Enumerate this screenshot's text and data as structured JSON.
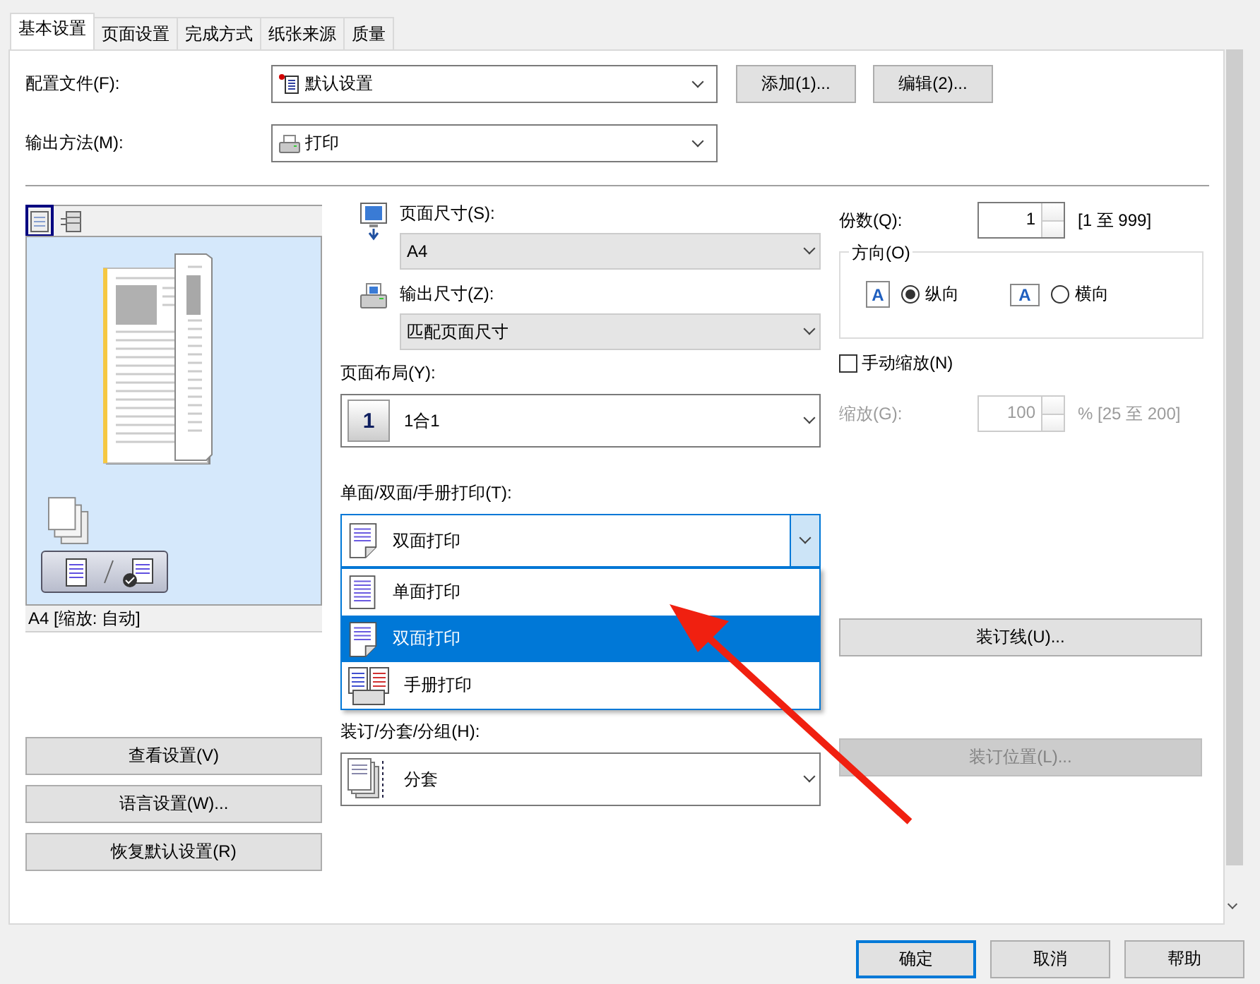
{
  "tabs": [
    {
      "label": "基本设置",
      "selected": true
    },
    {
      "label": "页面设置",
      "selected": false
    },
    {
      "label": "完成方式",
      "selected": false
    },
    {
      "label": "纸张来源",
      "selected": false
    },
    {
      "label": "质量",
      "selected": false
    }
  ],
  "profile": {
    "label": "配置文件(F):",
    "value": "默认设置"
  },
  "profile_buttons": [
    "添加(1)...",
    "编辑(2)..."
  ],
  "output_method": {
    "label": "输出方法(M):",
    "value": "打印"
  },
  "view_modes": [
    {
      "kind": "page",
      "selected": true
    },
    {
      "kind": "printer",
      "selected": false
    }
  ],
  "preview": {
    "status": "A4 [缩放: 自动]"
  },
  "left_buttons": [
    "查看设置(V)",
    "语言设置(W)...",
    "恢复默认设置(R)"
  ],
  "page_size": {
    "label": "页面尺寸(S):",
    "value": "A4"
  },
  "output_size": {
    "label": "输出尺寸(Z):",
    "value": "匹配页面尺寸"
  },
  "layout": {
    "label": "页面布局(Y):",
    "icon_text": "1",
    "value": "1合1"
  },
  "duplex": {
    "label": "单面/双面/手册打印(T):",
    "value": "双面打印",
    "expanded": true,
    "options": [
      {
        "kind": "simplex",
        "label": "单面打印",
        "selected": false
      },
      {
        "kind": "duplex",
        "label": "双面打印",
        "selected": true
      },
      {
        "kind": "booklet",
        "label": "手册打印",
        "selected": false
      }
    ]
  },
  "binding": {
    "label": "装订/分套/分组(H):",
    "value": "分套"
  },
  "copies": {
    "label": "份数(Q):",
    "value": "1",
    "range": "[1 至 999]"
  },
  "orientation": {
    "title": "方向(O)",
    "options": [
      {
        "kind": "portrait",
        "icon_text": "A",
        "label": "纵向",
        "selected": true
      },
      {
        "kind": "landscape",
        "icon_text": "A",
        "label": "横向",
        "selected": false
      }
    ]
  },
  "manual_scale": {
    "label": "手动缩放(N)",
    "checked": false
  },
  "scale": {
    "label": "缩放(G):",
    "value": "100",
    "range": "% [25 至 200]",
    "disabled": true
  },
  "gutter_button": {
    "label": "装订线(U)...",
    "disabled": false
  },
  "binding_position_button": {
    "label": "装订位置(L)...",
    "disabled": true
  },
  "footer_buttons": [
    {
      "label": "确定",
      "default": true
    },
    {
      "label": "取消",
      "default": false
    },
    {
      "label": "帮助",
      "default": false
    }
  ]
}
